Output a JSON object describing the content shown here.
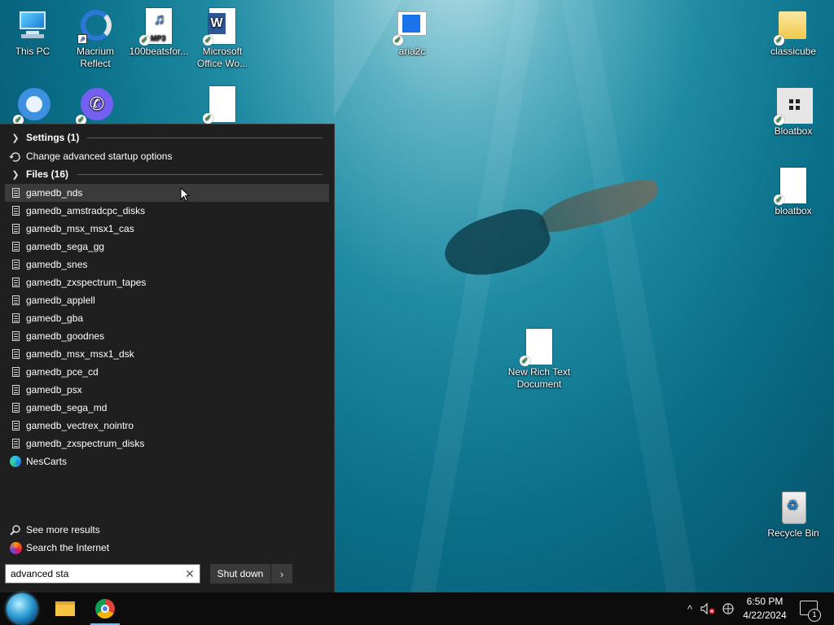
{
  "desktop": {
    "icons": {
      "this_pc": "This PC",
      "macrium": "Macrium Reflect",
      "beats": "100beatsfor...",
      "word": "Microsoft Office Wo...",
      "aria2c": "aria2c",
      "classicube": "classicube",
      "bloatbox_app": "Bloatbox",
      "bloatbox_file": "bloatbox",
      "new_rtf": "New Rich Text Document",
      "recycle_bin": "Recycle Bin"
    },
    "mp3_label": "MP3"
  },
  "search_panel": {
    "settings_header": "Settings (1)",
    "settings_items": [
      "Change advanced startup options"
    ],
    "files_header": "Files (16)",
    "files": [
      "gamedb_nds",
      "gamedb_amstradcpc_disks",
      "gamedb_msx_msx1_cas",
      "gamedb_sega_gg",
      "gamedb_snes",
      "gamedb_zxspectrum_tapes",
      "gamedb_applell",
      "gamedb_gba",
      "gamedb_goodnes",
      "gamedb_msx_msx1_dsk",
      "gamedb_pce_cd",
      "gamedb_psx",
      "gamedb_sega_md",
      "gamedb_vectrex_nointro",
      "gamedb_zxspectrum_disks"
    ],
    "web_item": "NesCarts",
    "see_more": "See more results",
    "search_internet": "Search the Internet",
    "query": "advanced sta",
    "clear_glyph": "✕",
    "shutdown_label": "Shut down",
    "shutdown_arrow": "›"
  },
  "taskbar": {
    "clock_time": "6:50 PM",
    "clock_date": "4/22/2024",
    "notification_count": "1",
    "tray_chevron": "^"
  },
  "icons": {
    "chevron": "chevron-right-icon",
    "file": "file-icon",
    "edge": "edge-icon",
    "search": "search-icon",
    "firefox": "firefox-icon"
  },
  "colors": {
    "panel_bg": "#1f1f1f",
    "hover_bg": "#3b3b3b",
    "taskbar_bg": "#0c0c0c",
    "sync_check": "#2f9a3e"
  }
}
